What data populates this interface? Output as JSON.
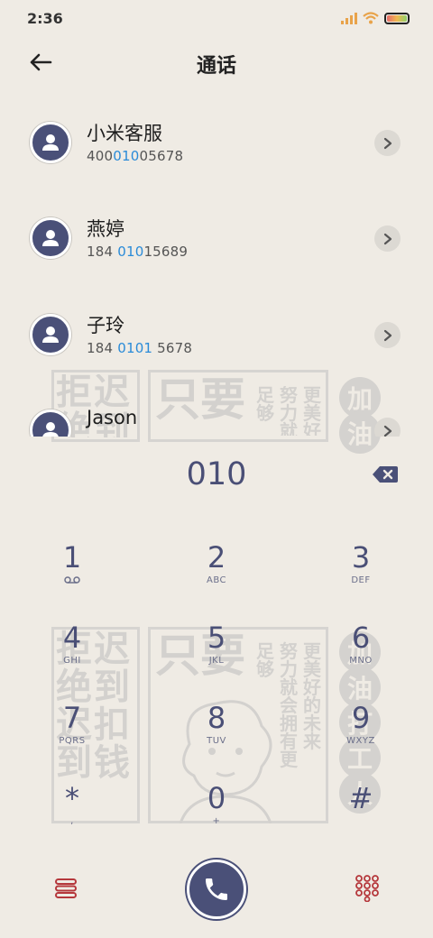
{
  "status_bar": {
    "time": "2:36",
    "battery_level": 0.9
  },
  "header": {
    "title": "通话",
    "back_icon": "arrow-left-icon"
  },
  "contacts": [
    {
      "name": "小米客服",
      "number_parts": [
        "400",
        "010",
        "05678"
      ]
    },
    {
      "name": "燕婷",
      "number_parts": [
        "184 ",
        "010",
        "15689"
      ]
    },
    {
      "name": "子玲",
      "number_parts": [
        "184 ",
        "0101",
        " 5678"
      ]
    },
    {
      "name": "Jason",
      "number_parts": [
        "",
        "",
        ""
      ]
    }
  ],
  "dialer": {
    "input": "010",
    "keys": [
      {
        "digit": "1",
        "letters": ""
      },
      {
        "digit": "2",
        "letters": "ABC"
      },
      {
        "digit": "3",
        "letters": "DEF"
      },
      {
        "digit": "4",
        "letters": "GHI"
      },
      {
        "digit": "5",
        "letters": "JKL"
      },
      {
        "digit": "6",
        "letters": "MNO"
      },
      {
        "digit": "7",
        "letters": "PQRS"
      },
      {
        "digit": "8",
        "letters": "TUV"
      },
      {
        "digit": "9",
        "letters": "WXYZ"
      },
      {
        "digit": "*",
        "letters": ","
      },
      {
        "digit": "0",
        "letters": "+"
      },
      {
        "digit": "#",
        "letters": ""
      }
    ]
  },
  "decor": {
    "left_text": [
      "拒",
      "迟",
      "绝",
      "到",
      "迟",
      "扣",
      "到",
      "钱"
    ],
    "center_big": "只要",
    "center_col1": [
      "足",
      "够"
    ],
    "center_col2": [
      "努",
      "力",
      "就",
      "会",
      "拥",
      "有",
      "更"
    ],
    "center_col3": [
      "更",
      "美",
      "好",
      "的",
      "未",
      "来"
    ],
    "right_circles": [
      "加",
      "油",
      "打",
      "工",
      "人"
    ]
  },
  "colors": {
    "accent": "#4a5078",
    "highlight": "#2a8bd8",
    "background": "#efebe4",
    "menu_red": "#b5383c"
  }
}
